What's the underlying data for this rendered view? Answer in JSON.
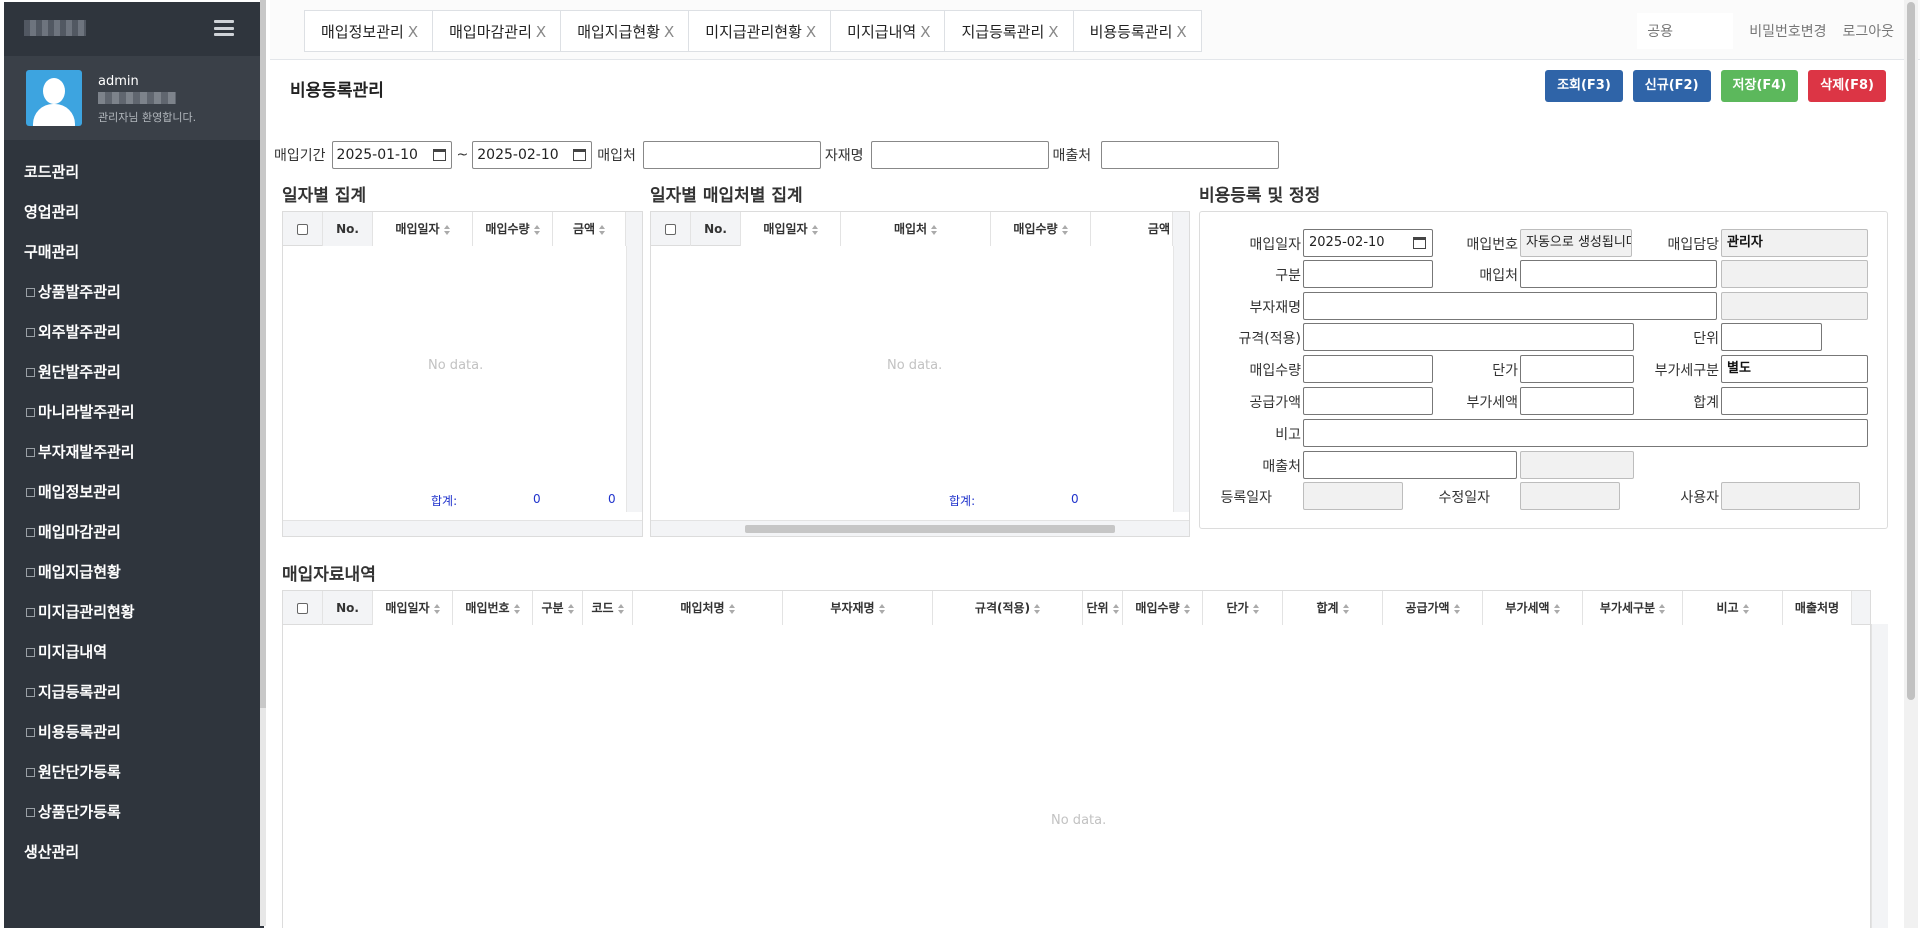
{
  "sidebar": {
    "user_name": "admin",
    "welcome": "관리자님 환영합니다.",
    "menu": [
      {
        "label": "코드관리",
        "sub": false
      },
      {
        "label": "영업관리",
        "sub": false
      },
      {
        "label": "구매관리",
        "sub": false
      },
      {
        "label": "상품발주관리",
        "sub": true
      },
      {
        "label": "외주발주관리",
        "sub": true
      },
      {
        "label": "원단발주관리",
        "sub": true
      },
      {
        "label": "마니라발주관리",
        "sub": true
      },
      {
        "label": "부자재발주관리",
        "sub": true
      },
      {
        "label": "매입정보관리",
        "sub": true
      },
      {
        "label": "매입마감관리",
        "sub": true
      },
      {
        "label": "매입지급현황",
        "sub": true
      },
      {
        "label": "미지급관리현황",
        "sub": true
      },
      {
        "label": "미지급내역",
        "sub": true
      },
      {
        "label": "지급등록관리",
        "sub": true
      },
      {
        "label": "비용등록관리",
        "sub": true
      },
      {
        "label": "원단단가등록",
        "sub": true
      },
      {
        "label": "상품단가등록",
        "sub": true
      },
      {
        "label": "생산관리",
        "sub": false
      }
    ]
  },
  "tabs": [
    {
      "label": "매입정보관리",
      "close": "X"
    },
    {
      "label": "매입마감관리",
      "close": "X"
    },
    {
      "label": "매입지급현황",
      "close": "X"
    },
    {
      "label": "미지급관리현황",
      "close": "X"
    },
    {
      "label": "미지급내역",
      "close": "X"
    },
    {
      "label": "지급등록관리",
      "close": "X"
    },
    {
      "label": "비용등록관리",
      "close": "X"
    }
  ],
  "topbar": {
    "search_placeholder": "공용",
    "change_password": "비밀번호변경",
    "logout": "로그아웃"
  },
  "page": {
    "title": "비용등록관리",
    "buttons": {
      "search": "조회(F3)",
      "new": "신규(F2)",
      "save": "저장(F4)",
      "delete": "삭제(F8)"
    }
  },
  "filter": {
    "period_label": "매입기간",
    "date_from": "2025-01-10",
    "tilde": "~",
    "date_to": "2025-02-10",
    "vendor_label": "매입처",
    "vendor_value": "",
    "material_label": "자재명",
    "material_value": "",
    "customer_label": "매출처",
    "customer_value": ""
  },
  "grid_daily": {
    "title": "일자별 집계",
    "columns": [
      "No.",
      "매입일자",
      "매입수량",
      "금액"
    ],
    "no_data": "No data.",
    "sum_label": "합계:",
    "sum_qty": "0",
    "sum_amount": "0"
  },
  "grid_daily_vendor": {
    "title": "일자별 매입처별 집계",
    "columns": [
      "No.",
      "매입일자",
      "매입처",
      "매입수량",
      "금액"
    ],
    "no_data": "No data.",
    "sum_label": "합계:",
    "sum_qty": "0"
  },
  "form": {
    "title": "비용등록 및 정정",
    "purchase_date_label": "매입일자",
    "purchase_date": "2025-02-10",
    "purchase_no_label": "매입번호",
    "purchase_no": "자동으로 생성됩니다",
    "manager_label": "매입담당",
    "manager": "관리자",
    "category_label": "구분",
    "vendor_label": "매입처",
    "material_label": "부자재명",
    "spec_label": "규격(적용)",
    "unit_label": "단위",
    "qty_label": "매입수량",
    "price_label": "단가",
    "vat_type_label": "부가세구분",
    "vat_type": "별도",
    "supply_label": "공급가액",
    "vat_label": "부가세액",
    "total_label": "합계",
    "note_label": "비고",
    "customer_label": "매출처",
    "reg_date_label": "등록일자",
    "mod_date_label": "수정일자",
    "user_label": "사용자"
  },
  "grid_detail": {
    "title": "매입자료내역",
    "columns": [
      "No.",
      "매입일자",
      "매입번호",
      "구분",
      "코드",
      "매입처명",
      "부자재명",
      "규격(적용)",
      "단위",
      "매입수량",
      "단가",
      "합계",
      "공급가액",
      "부가세액",
      "부가세구분",
      "비고",
      "매출처명"
    ],
    "no_data": "No data."
  },
  "colors": {
    "sidebar_bg": "#2f353d",
    "btn_blue": "#2f64a8",
    "btn_green": "#5cb85c",
    "btn_red": "#dc3545",
    "sum_text": "#2033cc"
  }
}
